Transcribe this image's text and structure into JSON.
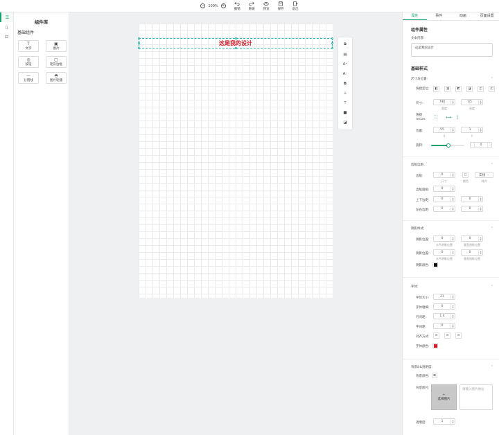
{
  "toolbar": {
    "zoom": "100%",
    "zoom_out": "−",
    "zoom_in": "+",
    "actions": [
      "撤销",
      "重做",
      "预览",
      "保存",
      "退出"
    ]
  },
  "library": {
    "title": "组件库",
    "section": "基础组件",
    "components": [
      {
        "label": "文字",
        "glyph": "T"
      },
      {
        "label": "图片",
        "glyph": "▣"
      },
      {
        "label": "按钮",
        "glyph": "◎"
      },
      {
        "label": "矩形边框",
        "glyph": "▢"
      },
      {
        "label": "分割线",
        "glyph": "—"
      },
      {
        "label": "图片轮播",
        "glyph": "◓"
      }
    ]
  },
  "canvas": {
    "text": "这是我的设计",
    "tools": [
      "⧉",
      "▤",
      "A⁺",
      "A⁻",
      "B",
      "⊥",
      "⊤",
      "■",
      "◪"
    ]
  },
  "panel": {
    "tabs": [
      "属性",
      "事件",
      "动画",
      "页面设置"
    ],
    "component_props": "组件属性",
    "text_content_label": "文本内容:",
    "text_content_value": "这是我的设计",
    "base_style": "基础样式",
    "size_pos": "尺寸与位置:",
    "quick_pos_label": "快捷定位:",
    "size_label": "尺寸:",
    "width": "746",
    "height": "45",
    "width_sub": "宽度",
    "height_sub": "高度",
    "quick_resize_label": "快捷 resize:",
    "position_label": "位置:",
    "x": "55",
    "y": "1",
    "x_sub": "X",
    "y_sub": "Y",
    "rotate_label": "旋转:",
    "rotate": "0",
    "border_group": "边框边距:",
    "border_label": "边框:",
    "border_size": "0",
    "border_size_sub": "尺寸",
    "border_color_sub": "颜色",
    "border_style": "实线",
    "border_style_sub": "样式",
    "radius_label": "边框圆角:",
    "radius": "0",
    "padding_v_label": "上下边距:",
    "padding_v": "0",
    "padding_v2": "0",
    "padding_h_label": "左右边距:",
    "padding_h": "0",
    "padding_h2": "0",
    "shadow_group": "阴影样式:",
    "shadow_pos_label": "阴影位置:",
    "shadow_pos_1": "0",
    "shadow_pos_2": "0",
    "shadow_h_sub": "水平阴影位置",
    "shadow_v_sub": "垂直阴影位置",
    "shadow_pos_label_2": "阴影位置:",
    "shadow_pos_3": "0",
    "shadow_pos_4": "0",
    "shadow_color_label": "阴影颜色:",
    "font_group": "字体:",
    "font_size_label": "字体大小:",
    "font_size": "21",
    "font_weight_label": "字体粗细:",
    "font_weight": "0",
    "line_height_label": "行间距:",
    "line_height": "1.4",
    "letter_spacing_label": "字间距:",
    "letter_spacing": "0",
    "align_label": "对齐方式:",
    "font_color_label": "字体颜色:",
    "bg_group": "背景&&透明度:",
    "bg_color_label": "背景颜色:",
    "bg_image_label": "背景图片:",
    "bg_image_button": "选择图片",
    "bg_image_placeholder": "请输入图片地址",
    "opacity_label": "透明度:",
    "opacity": "1"
  },
  "colors": {
    "accent": "#1aa06d",
    "title_text": "#d4202a",
    "selection": "#2bb7a8",
    "font_color": "#d4202a",
    "shadow_color": "#111111"
  }
}
